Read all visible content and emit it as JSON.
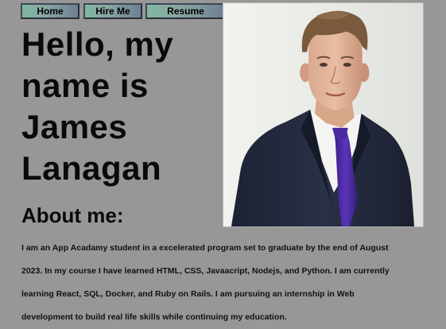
{
  "nav": {
    "home_label": "Home",
    "hire_label": "Hire Me",
    "resume_label": "Resume"
  },
  "hero": {
    "title": "Hello, my name is James Lanagan"
  },
  "profile_photo": {
    "alt": "Portrait of James Lanagan in a dark suit with a purple tie"
  },
  "about": {
    "heading": "About me:",
    "text": "I am an App Acadamy student in a excelerated program set to graduate by the end of August 2023. In my course I have learned HTML, CSS, Javaacript, Nodejs, and Python. I am currently learning React, SQL, Docker, and Ruby on Rails. I am pursuing an internship in Web development to build real life skills while continuing my education."
  },
  "colors": {
    "page_background": "#979797",
    "button_gradient_start": "#7fb8a2",
    "button_gradient_end": "#6d7f93",
    "text": "#0a0a0a"
  }
}
